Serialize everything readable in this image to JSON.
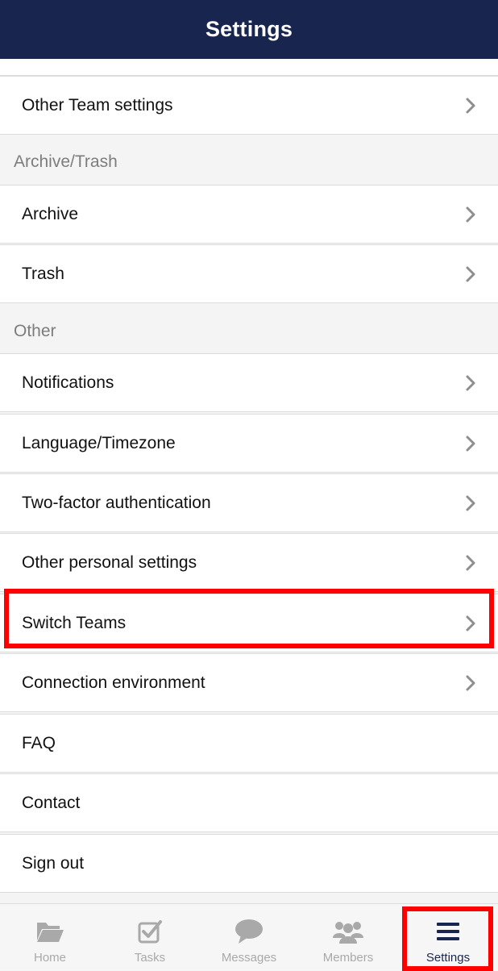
{
  "header": {
    "title": "Settings"
  },
  "sections": {
    "archive_trash": {
      "label": "Archive/Trash"
    },
    "other": {
      "label": "Other"
    }
  },
  "rows": {
    "other_team_settings": "Other Team settings",
    "archive": "Archive",
    "trash": "Trash",
    "notifications": "Notifications",
    "language_timezone": "Language/Timezone",
    "two_factor": "Two-factor authentication",
    "other_personal": "Other personal settings",
    "switch_teams": "Switch Teams",
    "connection_env": "Connection environment",
    "faq": "FAQ",
    "contact": "Contact",
    "sign_out": "Sign out"
  },
  "tabbar": {
    "home": "Home",
    "tasks": "Tasks",
    "messages": "Messages",
    "members": "Members",
    "settings": "Settings",
    "active": "settings"
  },
  "colors": {
    "header_bg": "#18254f",
    "highlight": "#ff0000",
    "inactive_tab": "#a9a9a9"
  },
  "icons": {
    "row_chevron": "chevron-right-icon",
    "home": "folder-open-icon",
    "tasks": "checkbox-icon",
    "messages": "speech-bubble-icon",
    "members": "group-icon",
    "settings": "hamburger-menu-icon"
  }
}
